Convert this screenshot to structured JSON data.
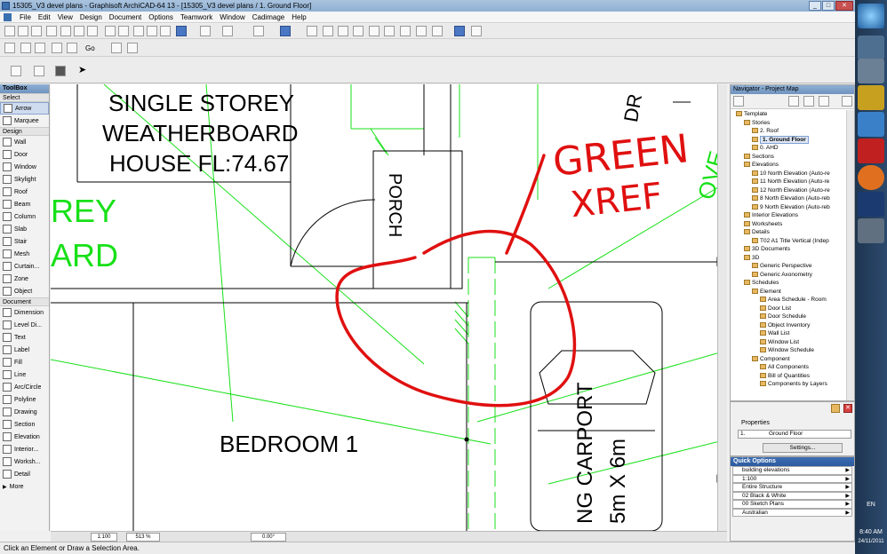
{
  "window": {
    "title": "15305_V3 devel plans - Graphisoft ArchiCAD-64 13 - [15305_V3 devel plans / 1. Ground Floor]"
  },
  "menu": [
    "File",
    "Edit",
    "View",
    "Design",
    "Document",
    "Options",
    "Teamwork",
    "Window",
    "Cadimage",
    "Help"
  ],
  "toolbar": {
    "go_label": "Go"
  },
  "toolbox": {
    "title": "ToolBox",
    "select_label": "Select",
    "select_tools": [
      "Arrow",
      "Marquee"
    ],
    "design_label": "Design",
    "design_tools": [
      "Wall",
      "Door",
      "Window",
      "Skylight",
      "Roof",
      "Beam",
      "Column",
      "Slab",
      "Stair",
      "Mesh",
      "Curtain...",
      "Zone",
      "Object"
    ],
    "document_label": "Document",
    "document_tools": [
      "Dimension",
      "Level Di...",
      "Text",
      "Label",
      "Fill",
      "Line",
      "Arc/Circle",
      "Polyline",
      "Drawing",
      "Section",
      "Elevation",
      "Interior...",
      "Worksh...",
      "Detail"
    ],
    "more_label": "More"
  },
  "plan": {
    "title_line1": "SINGLE STOREY",
    "title_line2": "WEATHERBOARD",
    "title_line3": "HOUSE FL:74.67",
    "porch_label": "PORCH",
    "bedroom_label": "BEDROOM 1",
    "carport_label": "NG CARPORT",
    "carport_size": "5m X 6m",
    "green_left1": "REY",
    "green_left2": "ARD",
    "green_right": "OVE",
    "black_top": "DR",
    "annotation_line1": "GREEN",
    "annotation_line2": "XREF"
  },
  "canvas_bar": {
    "scale": "1:100",
    "zoom": "513 %",
    "angle": "0.00°"
  },
  "navigator": {
    "title": "Navigator - Project Map",
    "tree": [
      {
        "label": "Template",
        "level": 0
      },
      {
        "label": "Stories",
        "level": 1
      },
      {
        "label": "2. Roof",
        "level": 2
      },
      {
        "label": "1. Ground Floor",
        "level": 2,
        "selected": true
      },
      {
        "label": "0. AHD",
        "level": 2
      },
      {
        "label": "Sections",
        "level": 1
      },
      {
        "label": "Elevations",
        "level": 1
      },
      {
        "label": "10 North Elevation (Auto-re",
        "level": 2
      },
      {
        "label": "11 North Elevation (Auto-re",
        "level": 2
      },
      {
        "label": "12 North Elevation (Auto-re",
        "level": 2
      },
      {
        "label": "8 North Elevation (Auto-reb",
        "level": 2
      },
      {
        "label": "9 North Elevation (Auto-reb",
        "level": 2
      },
      {
        "label": "Interior Elevations",
        "level": 1
      },
      {
        "label": "Worksheets",
        "level": 1
      },
      {
        "label": "Details",
        "level": 1
      },
      {
        "label": "T02 A1 Title Vertical (Indep",
        "level": 2
      },
      {
        "label": "3D Documents",
        "level": 1
      },
      {
        "label": "3D",
        "level": 1
      },
      {
        "label": "Generic Perspective",
        "level": 2
      },
      {
        "label": "Generic Axonometry",
        "level": 2
      },
      {
        "label": "Schedules",
        "level": 1
      },
      {
        "label": "Element",
        "level": 2
      },
      {
        "label": "Area Schedule - Room",
        "level": 3
      },
      {
        "label": "Door List",
        "level": 3
      },
      {
        "label": "Door Schedule",
        "level": 3
      },
      {
        "label": "Object Inventory",
        "level": 3
      },
      {
        "label": "Wall List",
        "level": 3
      },
      {
        "label": "Window List",
        "level": 3
      },
      {
        "label": "Window Schedule",
        "level": 3
      },
      {
        "label": "Component",
        "level": 2
      },
      {
        "label": "All Components",
        "level": 3
      },
      {
        "label": "Bill of Quantities",
        "level": 3
      },
      {
        "label": "Components by Layers",
        "level": 3
      }
    ]
  },
  "properties": {
    "title": "Properties",
    "id_value": "1.",
    "name_value": "Ground Floor",
    "settings_button": "Settings..."
  },
  "quick_options": {
    "title": "Quick Options",
    "rows": [
      "building elevations",
      "1:100",
      "Entire Structure",
      "02 Black & White",
      "00 Sketch Plans",
      "Australian"
    ]
  },
  "status": {
    "message": "Click an Element or Draw a Selection Area."
  },
  "tray": {
    "lang": "EN",
    "time": "8:40 AM",
    "date": "24/11/2011"
  },
  "colors": {
    "xref_green": "#18e018",
    "annotation_red": "#e01010"
  }
}
